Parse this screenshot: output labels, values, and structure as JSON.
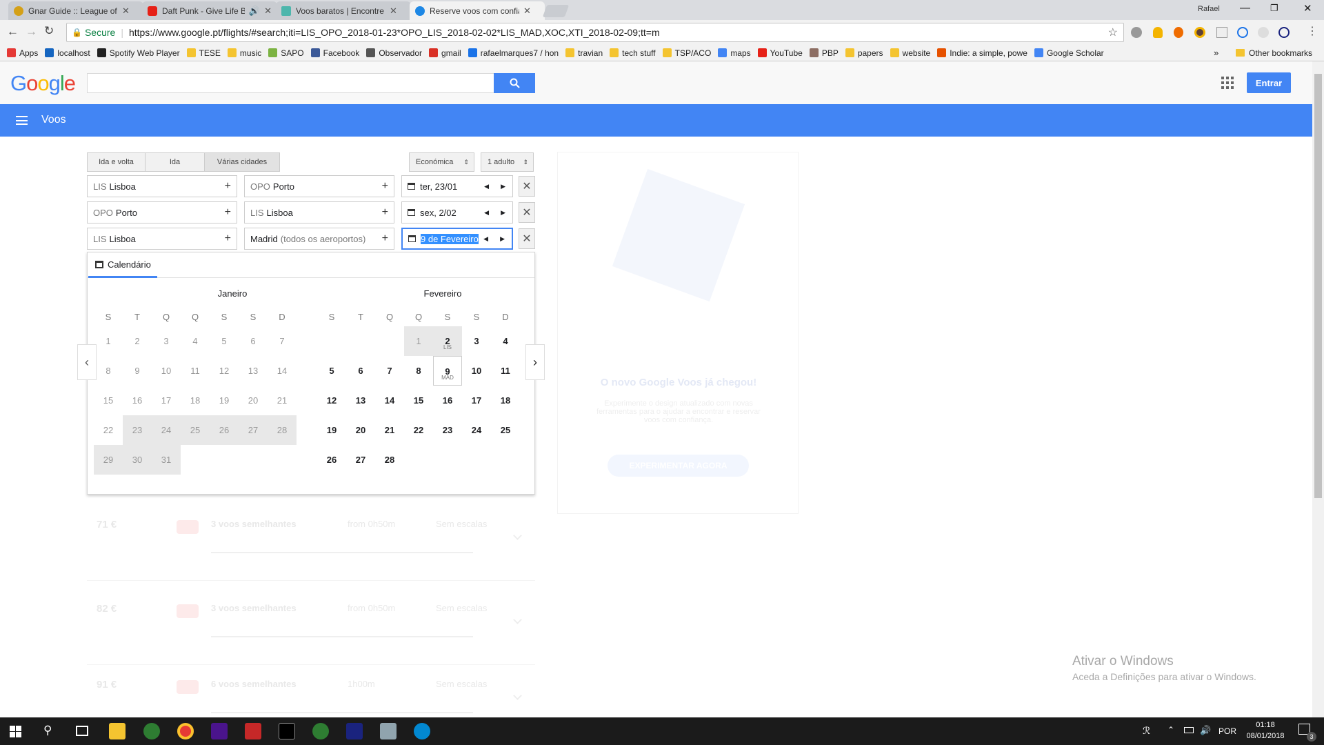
{
  "browser": {
    "tabs": [
      {
        "title": "Gnar Guide :: League of L",
        "color": "#d4a017"
      },
      {
        "title": "Daft Punk - Give Life B",
        "color": "#e62117"
      },
      {
        "title": "Voos baratos | Encontre v",
        "color": "#4db6ac"
      },
      {
        "title": "Reserve voos com confia",
        "color": "#1e88e5"
      }
    ],
    "user": "Rafael",
    "secure_label": "Secure",
    "url": "https://www.google.pt/flights/#search;iti=LIS_OPO_2018-01-23*OPO_LIS_2018-02-02*LIS_MAD,XOC,XTI_2018-02-09;tt=m",
    "bookmarks": [
      {
        "label": "Apps",
        "color": "#e53935"
      },
      {
        "label": "localhost",
        "color": "#1565c0"
      },
      {
        "label": "Spotify Web Player",
        "color": "#222"
      },
      {
        "label": "TESE",
        "color": "#f4c430"
      },
      {
        "label": "music",
        "color": "#f4c430"
      },
      {
        "label": "SAPO",
        "color": "#7cb342"
      },
      {
        "label": "Facebook",
        "color": "#3b5998"
      },
      {
        "label": "Observador",
        "color": "#555"
      },
      {
        "label": "gmail",
        "color": "#d93025"
      },
      {
        "label": "rafaelmarques7 / hon",
        "color": "#1a73e8"
      },
      {
        "label": "travian",
        "color": "#f4c430"
      },
      {
        "label": "tech stuff",
        "color": "#f4c430"
      },
      {
        "label": "TSP/ACO",
        "color": "#f4c430"
      },
      {
        "label": "maps",
        "color": "#4285f4"
      },
      {
        "label": "YouTube",
        "color": "#e62117"
      },
      {
        "label": "PBP",
        "color": "#8d6e63"
      },
      {
        "label": "papers",
        "color": "#f4c430"
      },
      {
        "label": "website",
        "color": "#f4c430"
      },
      {
        "label": "Indie: a simple, powe",
        "color": "#e65100"
      },
      {
        "label": "Google Scholar",
        "color": "#4285f4"
      }
    ],
    "more_bookmarks": "»",
    "other_bookmarks": "Other bookmarks"
  },
  "header": {
    "logo": "Google",
    "signin": "Entrar",
    "section": "Voos"
  },
  "form": {
    "trip_types": [
      "Ida e volta",
      "Ida",
      "Várias cidades"
    ],
    "cabin": "Económica",
    "passengers": "1 adulto",
    "legs": [
      {
        "from_code": "LIS",
        "from": "Lisboa",
        "to_code": "OPO",
        "to": "Porto",
        "date": "ter, 23/01"
      },
      {
        "from_code": "OPO",
        "from": "Porto",
        "to_code": "LIS",
        "to": "Lisboa",
        "date": "sex, 2/02"
      },
      {
        "from_code": "LIS",
        "from": "Lisboa",
        "to_code": "",
        "to": "Madrid",
        "to_extra": "(todos os aeroportos)",
        "date": "9 de Fevereiro"
      }
    ]
  },
  "calendar": {
    "tab": "Calendário",
    "months": [
      {
        "name": "Janeiro",
        "dows": [
          "S",
          "T",
          "Q",
          "Q",
          "S",
          "S",
          "D"
        ]
      },
      {
        "name": "Fevereiro",
        "dows": [
          "S",
          "T",
          "Q",
          "Q",
          "S",
          "S",
          "D"
        ]
      }
    ],
    "feb_markers": {
      "2": "LIS",
      "9": "MAD"
    }
  },
  "background": {
    "promo_title": "O novo Google Voos já chegou!",
    "promo_text": "Experimente o design atualizado com novas ferramentas para o ajudar a encontrar e reservar voos com confiança.",
    "promo_button": "EXPERIMENTAR AGORA",
    "results": [
      {
        "price": "71 €",
        "title": "3 voos semelhantes",
        "time": "from 0h50m",
        "stops": "Sem escalas"
      },
      {
        "price": "82 €",
        "title": "3 voos semelhantes",
        "time": "from 0h50m",
        "stops": "Sem escalas"
      },
      {
        "price": "91 €",
        "title": "6 voos semelhantes",
        "time": "1h00m",
        "stops": "Sem escalas"
      }
    ]
  },
  "watermark": {
    "title": "Ativar o Windows",
    "text": "Aceda a Definições para ativar o Windows."
  },
  "taskbar": {
    "lang": "POR",
    "time": "01:18",
    "date": "08/01/2018",
    "notif": "3"
  }
}
